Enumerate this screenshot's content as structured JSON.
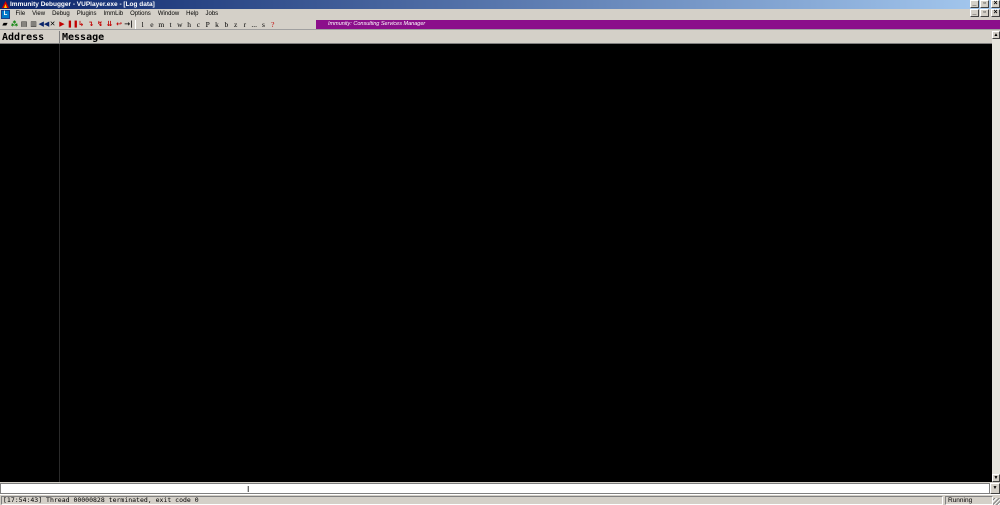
{
  "window": {
    "title": "Immunity Debugger - VUPlayer.exe - [Log data]",
    "controls": [
      "minimize",
      "restore",
      "close"
    ]
  },
  "menubar": {
    "items": [
      "File",
      "View",
      "Debug",
      "Plugins",
      "ImmLib",
      "Options",
      "Window",
      "Help",
      "Jobs"
    ]
  },
  "toolbar": {
    "letters": [
      "l",
      "e",
      "m",
      "t",
      "w",
      "h",
      "c",
      "P",
      "k",
      "b",
      "z",
      "r",
      "...",
      "s",
      "?"
    ],
    "banner": "Immunity: Consulting Services Manager"
  },
  "log": {
    "columns": [
      "Address",
      "Message"
    ],
    "rows": []
  },
  "command": {
    "value": ""
  },
  "status": {
    "message": "[17:54:43] Thread 00000828 terminated, exit code 0",
    "state": "Running"
  }
}
